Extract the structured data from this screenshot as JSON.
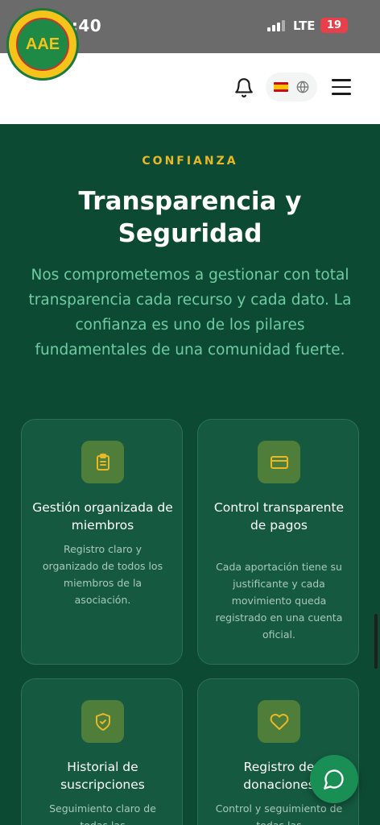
{
  "status_bar": {
    "time": "13:40",
    "network": "LTE",
    "battery": "19"
  },
  "header": {
    "logo_text": "AAE"
  },
  "section": {
    "eyebrow": "CONFIANZA",
    "title": "Transparencia y Seguridad",
    "subtitle": "Nos comprometemos a gestionar con total transparencia cada recurso y cada dato. La confianza es uno de los pilares fundamentales de una comunidad fuerte."
  },
  "cards": [
    {
      "icon": "clipboard-icon",
      "title": "Gestión organizada de miembros",
      "desc": "Registro claro y organizado de todos los miembros de la asociación."
    },
    {
      "icon": "credit-card-icon",
      "title": "Control transparente de pagos",
      "desc": "Cada aportación tiene su justificante y cada movimiento queda registrado en una cuenta oficial."
    },
    {
      "icon": "shield-check-icon",
      "title": "Historial de suscripciones",
      "desc": "Seguimiento claro de todas las"
    },
    {
      "icon": "heart-icon",
      "title": "Registro de donaciones",
      "desc": "Control y seguimiento de todas las"
    }
  ],
  "colors": {
    "accent": "#e8b827",
    "background": "#0d4a34",
    "card": "#155a40",
    "subtitle": "#6fcca0"
  }
}
